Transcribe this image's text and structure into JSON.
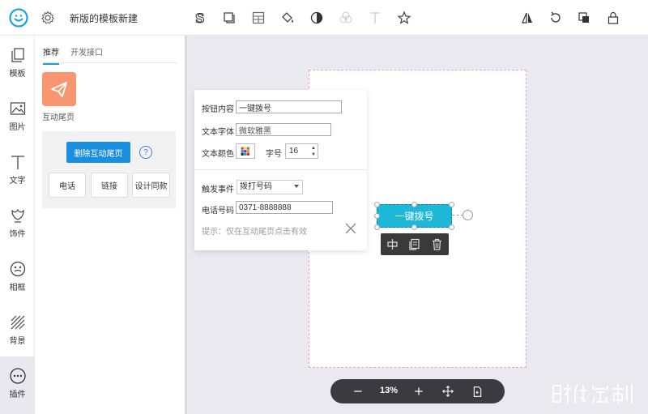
{
  "app": {
    "title": "新版的模板新建"
  },
  "toolbar": {
    "icons": [
      "stroke-text-icon",
      "shadow-icon",
      "table-icon",
      "fill-bucket-icon",
      "contrast-icon",
      "blend-icon",
      "text-icon",
      "favorite-star-icon"
    ],
    "right_icons": [
      "flip-icon",
      "rotate-icon",
      "layer-icon",
      "lock-icon"
    ]
  },
  "rail": {
    "items": [
      {
        "label": "模板",
        "icon": "template-icon"
      },
      {
        "label": "图片",
        "icon": "image-icon"
      },
      {
        "label": "文字",
        "icon": "text-icon"
      },
      {
        "label": "饰件",
        "icon": "decoration-icon"
      },
      {
        "label": "相框",
        "icon": "frame-icon"
      },
      {
        "label": "背景",
        "icon": "background-icon"
      },
      {
        "label": "插件",
        "icon": "plugin-icon"
      }
    ]
  },
  "panel": {
    "tabs": [
      "推荐",
      "开发接口"
    ],
    "tile_label": "互动尾页",
    "delete_label": "删除互动尾页",
    "help": "?",
    "options": [
      "电话",
      "链接",
      "设计同款"
    ]
  },
  "popup": {
    "button_content_label": "按钮内容",
    "button_content_value": "一键拨号",
    "font_label": "文本字体",
    "font_value": "微软雅黑",
    "color_label": "文本颜色",
    "size_label": "字号",
    "size_value": "16",
    "trigger_label": "触发事件",
    "trigger_value": "拨打号码",
    "phone_label": "电话号码",
    "phone_value": "0371-8888888",
    "hint": "提示：仅在互动尾页点击有效"
  },
  "canvas": {
    "button_text": "一键拨号"
  },
  "zoom": {
    "value": "13%"
  },
  "colors": {
    "accent": "#1a8fe0",
    "selected_button": "#1db7d8",
    "tile": "#f8966f"
  }
}
